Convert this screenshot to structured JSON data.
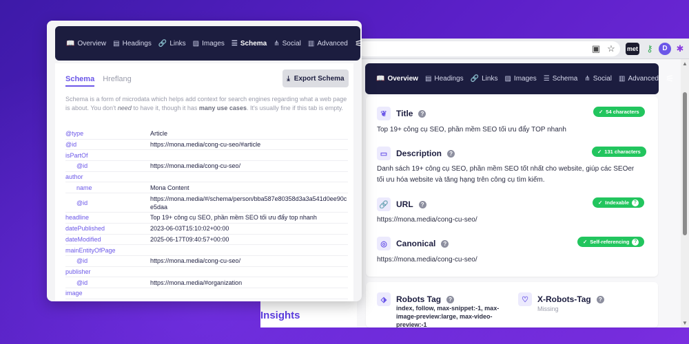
{
  "browser": {
    "ext_labels": [
      "met"
    ]
  },
  "left_nav": [
    {
      "label": "Overview",
      "icon": "book-icon"
    },
    {
      "label": "Headings",
      "icon": "doc-icon"
    },
    {
      "label": "Links",
      "icon": "link-icon"
    },
    {
      "label": "Images",
      "icon": "image-icon"
    },
    {
      "label": "Schema",
      "icon": "schema-icon"
    },
    {
      "label": "Social",
      "icon": "share-icon"
    },
    {
      "label": "Advanced",
      "icon": "advanced-icon"
    }
  ],
  "schema_panel": {
    "tabs": [
      "Schema",
      "Hreflang"
    ],
    "export_label": "Export Schema",
    "desc_1": "Schema is a form of microdata which helps add context for search engines regarding what a web page is about. You don't ",
    "desc_need": "need",
    "desc_2": " to have it, though it has ",
    "desc_many": "many use cases",
    "desc_3": ". It's usually fine if this tab is empty.",
    "rows": [
      {
        "key": "@type",
        "value": "Article"
      },
      {
        "key": "@id",
        "value": "https://mona.media/cong-cu-seo/#article"
      },
      {
        "key": "isPartOf",
        "value": ""
      },
      {
        "key": "@id",
        "value": "https://mona.media/cong-cu-seo/"
      },
      {
        "key": "author",
        "value": ""
      },
      {
        "key": "name",
        "value": "Mona Content"
      },
      {
        "key": "@id",
        "value": "https://mona.media/#/schema/person/bba587e80358d3a3a541d0ee90ce5daa"
      },
      {
        "key": "headline",
        "value": "Top 19+ công cụ SEO, phần mềm SEO tối ưu đẩy top nhanh"
      },
      {
        "key": "datePublished",
        "value": "2023-06-03T15:10:02+00:00"
      },
      {
        "key": "dateModified",
        "value": "2025-06-17T09:40:57+00:00"
      },
      {
        "key": "mainEntityOfPage",
        "value": ""
      },
      {
        "key": "@id",
        "value": "https://mona.media/cong-cu-seo/"
      },
      {
        "key": "publisher",
        "value": ""
      },
      {
        "key": "@id",
        "value": "https://mona.media/#organization"
      },
      {
        "key": "image",
        "value": ""
      }
    ]
  },
  "right_nav": [
    {
      "label": "Overview",
      "icon": "book-icon"
    },
    {
      "label": "Headings",
      "icon": "doc-icon"
    },
    {
      "label": "Links",
      "icon": "link-icon"
    },
    {
      "label": "Images",
      "icon": "image-icon"
    },
    {
      "label": "Schema",
      "icon": "schema-icon"
    },
    {
      "label": "Social",
      "icon": "share-icon"
    },
    {
      "label": "Advanced",
      "icon": "advanced-icon"
    }
  ],
  "overview": {
    "title": {
      "label": "Title",
      "badge": "54 characters",
      "value": "Top 19+ công cụ SEO, phần mềm SEO tối ưu đẩy TOP nhanh"
    },
    "description": {
      "label": "Description",
      "badge": "131 characters",
      "value_1": "Danh sách 19+ công cụ SEO, phần mềm SEO tốt nhất cho website, giúp các SEOer",
      "value_2": "tối ưu hóa website và tăng hạng trên công cụ tìm kiếm."
    },
    "url": {
      "label": "URL",
      "badge": "Indexable",
      "value": "https://mona.media/cong-cu-seo/"
    },
    "canonical": {
      "label": "Canonical",
      "badge": "Self-referencing",
      "value": "https://mona.media/cong-cu-seo/"
    },
    "robots": {
      "label": "Robots Tag",
      "value_1": "index, follow, max-snippet:-1, max-",
      "value_2": "image-preview:large, max-video-",
      "value_3": "preview:-1"
    },
    "xrobots": {
      "label": "X-Robots-Tag",
      "value": "Missing"
    }
  },
  "background_text": "Insights",
  "colors": {
    "accent": "#6b57e8",
    "nav_bg": "#1c1d3f",
    "badge_green": "#22c55e"
  }
}
